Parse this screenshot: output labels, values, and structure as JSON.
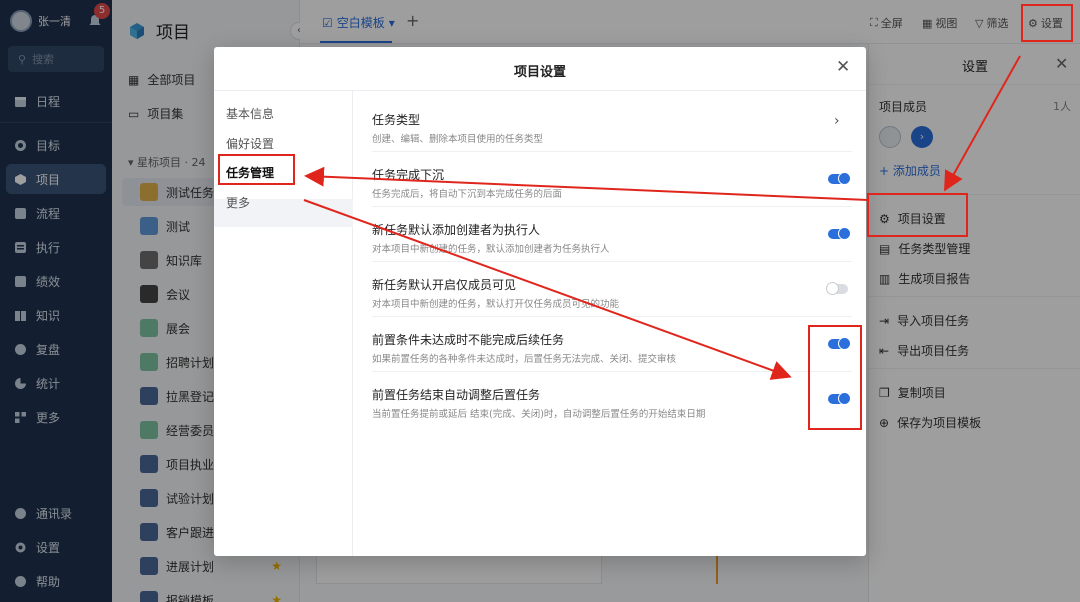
{
  "sidebar": {
    "user_name": "张一清",
    "notification_count": "5",
    "search_placeholder": "搜索",
    "items": [
      {
        "label": "日程",
        "icon": "calendar-icon"
      },
      {
        "label": "目标",
        "icon": "target-icon"
      },
      {
        "label": "项目",
        "icon": "project-icon",
        "active": true
      },
      {
        "label": "流程",
        "icon": "flow-icon"
      },
      {
        "label": "执行",
        "icon": "execute-icon"
      },
      {
        "label": "绩效",
        "icon": "performance-icon"
      },
      {
        "label": "知识",
        "icon": "book-icon"
      },
      {
        "label": "复盘",
        "icon": "review-icon"
      },
      {
        "label": "统计",
        "icon": "pie-chart-icon"
      },
      {
        "label": "更多",
        "icon": "grid-plus-icon"
      }
    ],
    "bottom_items": [
      {
        "label": "通讯录",
        "icon": "contacts-icon"
      },
      {
        "label": "设置",
        "icon": "gear-icon"
      },
      {
        "label": "帮助",
        "icon": "help-icon"
      }
    ]
  },
  "project_column": {
    "title": "项目",
    "all_projects": "全部项目",
    "project_sets": "项目集",
    "starred_header": "星标项目 · 24",
    "projects": [
      {
        "name": "测试任务",
        "active": true,
        "starred": false
      },
      {
        "name": "测试",
        "starred": false
      },
      {
        "name": "知识库",
        "starred": false
      },
      {
        "name": "会议",
        "starred": false
      },
      {
        "name": "展会",
        "starred": false
      },
      {
        "name": "招聘计划",
        "starred": false
      },
      {
        "name": "拉黑登记",
        "starred": false
      },
      {
        "name": "经营委员会",
        "starred": false
      },
      {
        "name": "项目执业",
        "starred": false
      },
      {
        "name": "试验计划",
        "starred": false
      },
      {
        "name": "客户跟进",
        "starred": false
      },
      {
        "name": "进展计划",
        "starred": true
      },
      {
        "name": "报销模板",
        "starred": true
      }
    ]
  },
  "topbar": {
    "tab_label": "空白模板",
    "fullscreen": "全屏",
    "view": "视图",
    "filter": "筛选",
    "settings": "设置"
  },
  "right_panel": {
    "title": "设置",
    "members_label": "项目成员",
    "members_count": "1人",
    "add_member": "添加成员",
    "items": [
      {
        "label": "项目设置",
        "icon": "gear-icon"
      },
      {
        "label": "任务类型管理",
        "icon": "task-type-icon"
      },
      {
        "label": "生成项目报告",
        "icon": "report-icon"
      },
      {
        "label": "导入项目任务",
        "icon": "import-icon"
      },
      {
        "label": "导出项目任务",
        "icon": "export-icon"
      },
      {
        "label": "复制项目",
        "icon": "copy-icon"
      },
      {
        "label": "保存为项目模板",
        "icon": "template-icon"
      }
    ]
  },
  "modal": {
    "title": "项目设置",
    "nav": [
      "基本信息",
      "偏好设置",
      "任务管理",
      "更多"
    ],
    "active_nav": "任务管理",
    "rows": [
      {
        "title": "任务类型",
        "desc": "创建、编辑、删除本项目使用的任务类型",
        "control": "chevron"
      },
      {
        "title": "任务完成下沉",
        "desc": "任务完成后，将自动下沉到本完成任务的后面",
        "control": "toggle",
        "on": true
      },
      {
        "title": "新任务默认添加创建者为执行人",
        "desc": "对本项目中新创建的任务，默认添加创建者为任务执行人",
        "control": "toggle",
        "on": true
      },
      {
        "title": "新任务默认开启仅成员可见",
        "desc": "对本项目中新创建的任务，默认打开仅任务成员可见的功能",
        "control": "toggle",
        "on": false
      },
      {
        "title": "前置条件未达成时不能完成后续任务",
        "desc": "如果前置任务的各种条件未达成时，后置任务无法完成、关闭、提交审核",
        "control": "toggle",
        "on": true
      },
      {
        "title": "前置任务结束自动调整后置任务",
        "desc": "当前置任务提前或延后 结束(完成、关闭)时，自动调整后置任务的开始结束日期",
        "control": "toggle",
        "on": true
      }
    ]
  },
  "colors": {
    "accent": "#2b6fdc",
    "sidebar": "#1f3350",
    "annotation": "#e0261c"
  }
}
